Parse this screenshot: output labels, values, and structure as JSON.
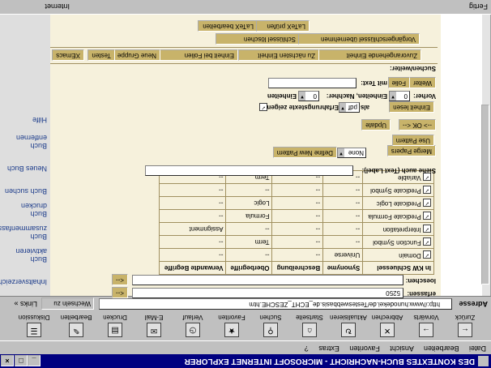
{
  "window": {
    "title": "DES KONTEXTES BUCH-NACHRICHT - MICROSOFT INTERNET EXPLORER",
    "min": "_",
    "max": "□",
    "close": "×"
  },
  "menu": [
    "Datei",
    "Bearbeiten",
    "Ansicht",
    "Favoriten",
    "Extras",
    "?"
  ],
  "toolbar": [
    "Zurück",
    "Vorwärts",
    "Abbrechen",
    "Aktualisieren",
    "Startseite",
    "Suchen",
    "Favoriten",
    "Verlauf",
    "E-Mail",
    "Drucken",
    "Bearbeiten",
    "Diskussion"
  ],
  "address": {
    "label": "Adresse",
    "url": "http://www.hunodekei.de/Testeswebbasis.de_ECHT_ZESCHE.htm",
    "go": "Wechseln zu",
    "links": "Links »"
  },
  "sidebar": [
    "Inhaltsverzeichnis",
    "Buch aktivieren",
    "Buch zusammenfassen",
    "Buch drucken",
    "Buch suchen",
    "Neues Buch",
    "Buch entfernen",
    "Hilfe"
  ],
  "form": {
    "erfassen_label": "erfassen:",
    "erfassen_value": "5250",
    "erfassen_btn": "<--",
    "loeschen_label": "loeschen:",
    "loeschen_value": "",
    "loeschen_btn": "<--",
    "table": {
      "headers": [
        "In KW Schluessel",
        "Synonyme",
        "Beschreibung",
        "Oberbegriffe",
        "Verwandte Begriffe"
      ],
      "rows": [
        [
          "Domain",
          "Universe",
          "--",
          "--",
          "--"
        ],
        [
          "Function Symbol",
          "--",
          "--",
          "Term",
          "--"
        ],
        [
          "Interpretation",
          "--",
          "--",
          "--",
          "Assignment"
        ],
        [
          "Predicate Formula",
          "--",
          "--",
          "Formula",
          "--"
        ],
        [
          "Predicate Logic",
          "--",
          "--",
          "Logic",
          "--"
        ],
        [
          "Predicate Symbol",
          "--",
          "--",
          "--",
          "--"
        ],
        [
          "Variable",
          "--",
          "--",
          "Term",
          "--"
        ]
      ]
    },
    "siehe_label": "Siehe auch (Text Label):",
    "siehe_value": "",
    "merge_btn": "Merge Papers",
    "none_option": "None",
    "define_btn": "Define New Pattern",
    "use_btn": "Use Pattern",
    "ok_btn": "--> OK <--",
    "update_btn": "Update",
    "einheit_btn": "Einheit lesen",
    "als_label": "als",
    "als_value": "pdf",
    "erfahr_label": "Erfahrungstexte zeigen:",
    "vorher_label": "Vorher:",
    "vorher_value": "0",
    "einheiten_label": "Einheiten, Nachher:",
    "nachher_value": "0",
    "einheiten2_label": "Einheiten",
    "weiter_btn": "Weiter",
    "folie_btn": "Folie",
    "mit_text_label": "mit Text:",
    "mit_text_value": "",
    "suchen_label": "Suchen/weiter:",
    "actions": [
      "Zuvorangehende Einheit",
      "Zu nächsten Einheit",
      "Einheit bei Folien",
      "Neue Gruppe",
      "Testen",
      "XEmacs"
    ],
    "schluessel_btn": "Schlüssel löschen",
    "vorgaenger_btn": "Vorgängerschlüssel übernehmen",
    "latex_bearbeiten": "LaTeX bearbeiten",
    "latex_pruefen": "LaTeX prüfen"
  },
  "status": {
    "left": "Fertig",
    "right": "Internet"
  }
}
